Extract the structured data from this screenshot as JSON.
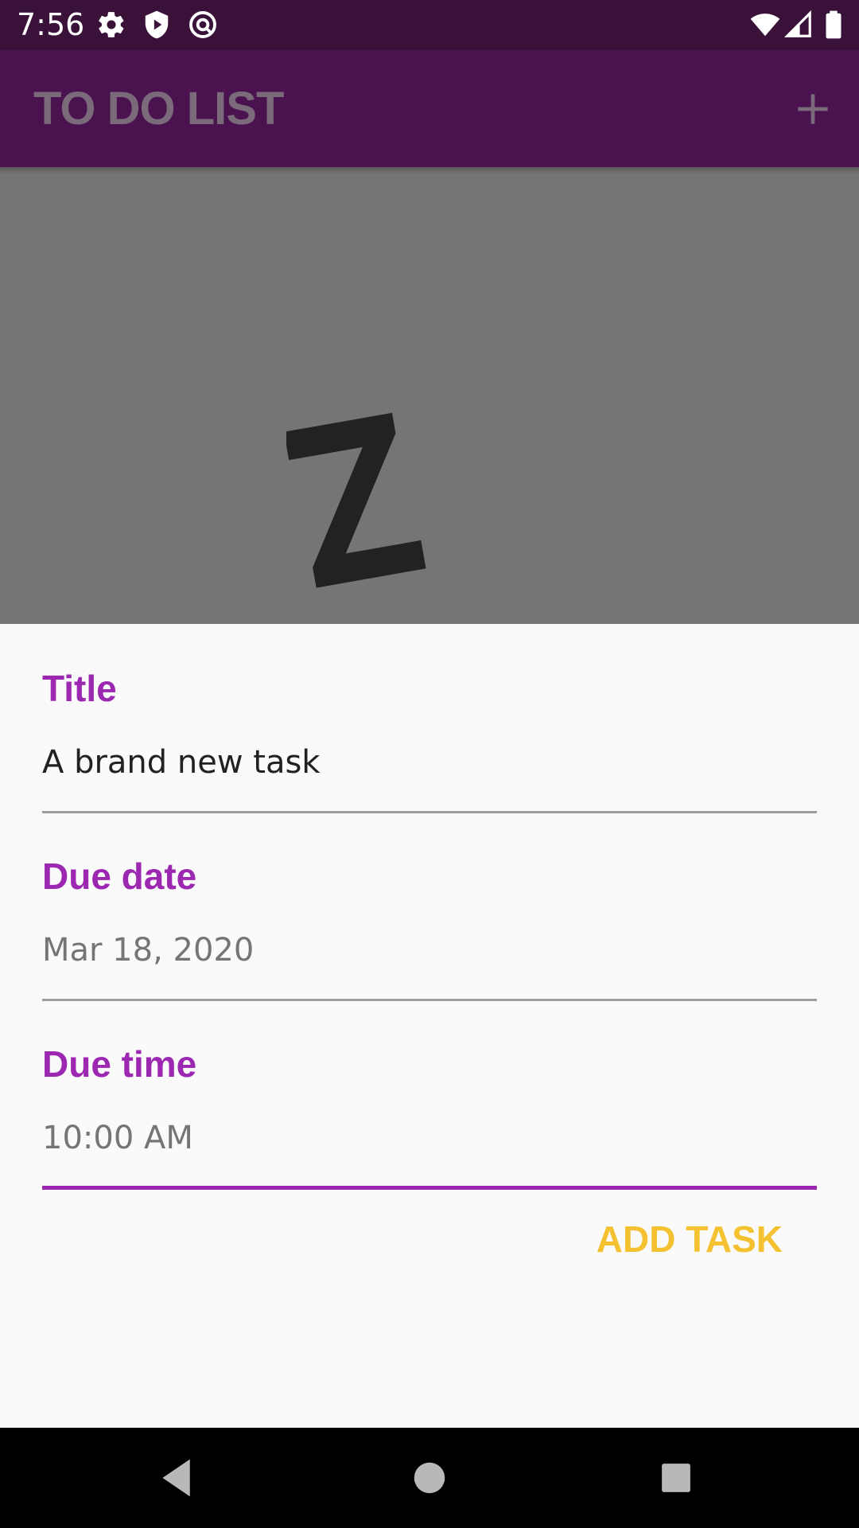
{
  "status_bar": {
    "time": "7:56",
    "left_icons": [
      "settings-icon",
      "shield-play-icon",
      "at-sign-icon"
    ],
    "right_icons": [
      "wifi-icon",
      "signal-icon",
      "battery-icon"
    ]
  },
  "app_bar": {
    "title": "TO DO LIST",
    "action_icon": "add-icon"
  },
  "hero": {
    "icon": "sleep-z-icon"
  },
  "form": {
    "title_label": "Title",
    "title_value": "A brand new task",
    "due_date_label": "Due date",
    "due_date_value": "Mar 18, 2020",
    "due_time_label": "Due time",
    "due_time_value": "10:00 AM",
    "submit_label": "ADD TASK"
  },
  "nav_bar": {
    "buttons": [
      "back-icon",
      "home-icon",
      "recents-icon"
    ]
  },
  "colors": {
    "status_bar": "#3a1139",
    "app_bar": "#4a1350",
    "accent": "#9c27b0",
    "button": "#f4c130",
    "hero": "#757575"
  }
}
